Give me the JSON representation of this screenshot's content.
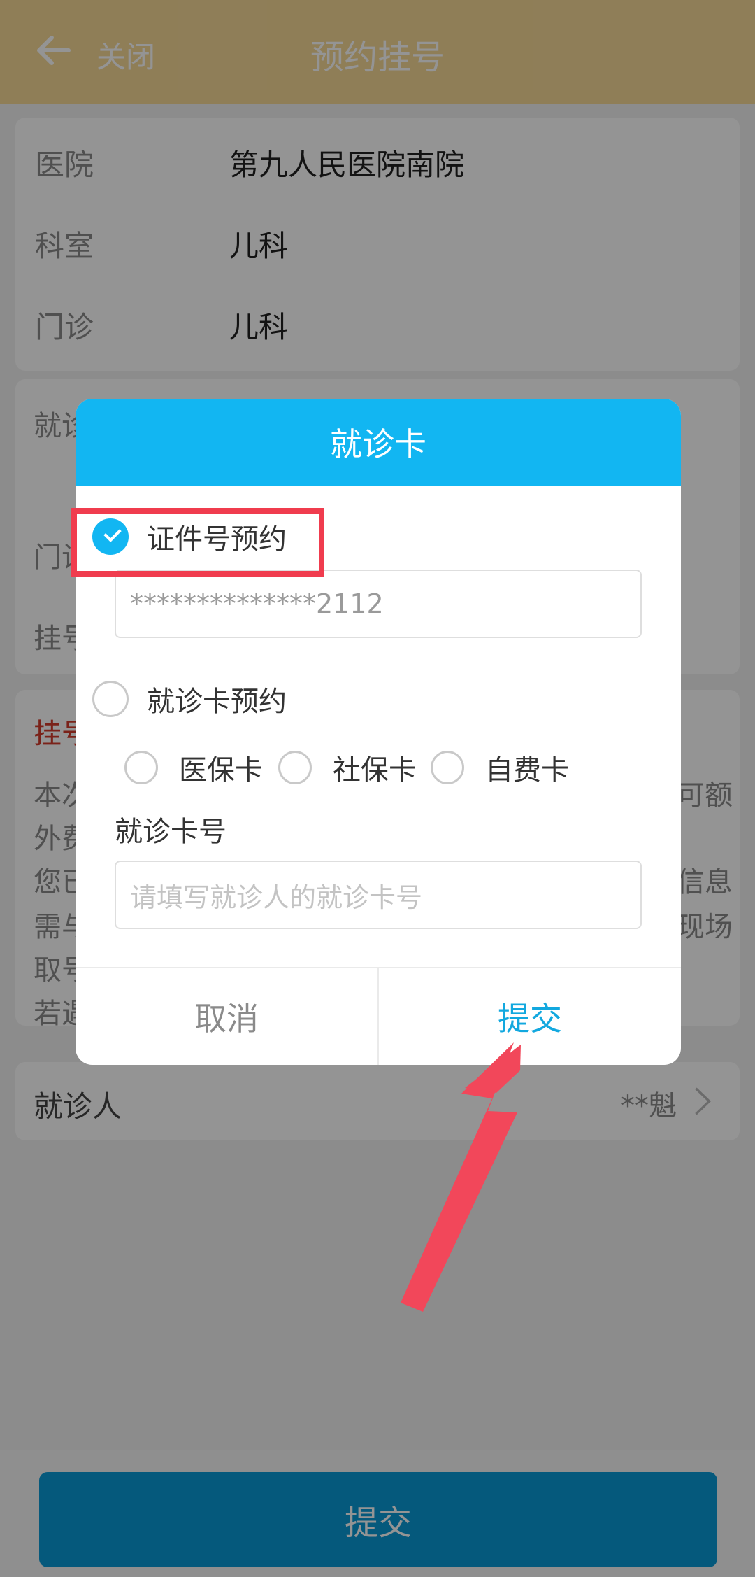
{
  "header": {
    "back_icon": "arrow-left-icon",
    "close_label": "关闭",
    "title": "预约挂号"
  },
  "info": [
    {
      "label": "医院",
      "value": "第九人民医院南院"
    },
    {
      "label": "科室",
      "value": "儿科"
    },
    {
      "label": "门诊",
      "value": "儿科"
    }
  ],
  "section2": {
    "label1": "就诊",
    "label2": "门诊",
    "label3": "挂号"
  },
  "notice": {
    "title": "挂号",
    "lines_left": [
      "本次",
      "外费",
      "您已",
      "需与",
      "取号",
      "若遇"
    ],
    "lines_right": [
      "可额",
      "",
      "信息",
      "现场",
      "",
      ""
    ]
  },
  "patient": {
    "label": "就诊人",
    "value": "**魁",
    "chevron_icon": "chevron-right-icon"
  },
  "bottom": {
    "submit_label": "提交"
  },
  "dialog": {
    "title": "就诊卡",
    "option_id": "证件号预约",
    "id_value": "**************2112",
    "option_card": "就诊卡预约",
    "card_types": [
      "医保卡",
      "社保卡",
      "自费卡"
    ],
    "card_no_label": "就诊卡号",
    "card_no_placeholder": "请填写就诊人的就诊卡号",
    "cancel_label": "取消",
    "submit_label": "提交"
  },
  "colors": {
    "accent": "#12b6f2",
    "header": "#f6d997",
    "annotation": "#f03c4e"
  }
}
